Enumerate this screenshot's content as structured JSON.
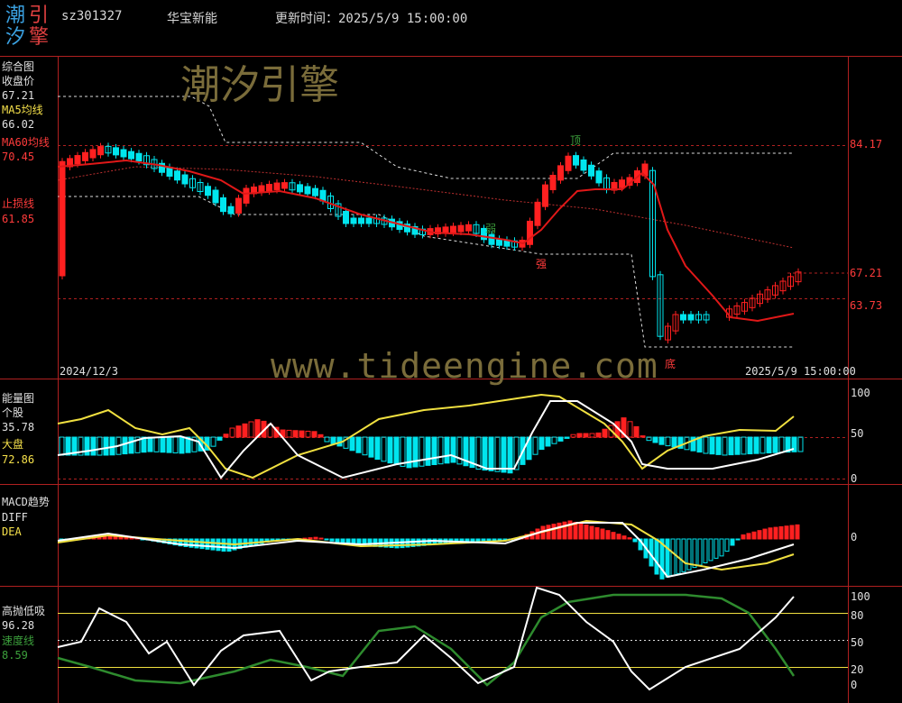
{
  "header": {
    "logo_chars": [
      "潮",
      "引",
      "汐",
      "擎"
    ],
    "code": "sz301327",
    "name": "华宝新能",
    "update_label": "更新时间：2025/5/9 15:00:00"
  },
  "watermarks": {
    "top": "潮汐引擎",
    "url": "www.tideengine.com"
  },
  "main_panel": {
    "title": "综合图",
    "close_label": "收盘价",
    "close_value": "67.21",
    "ma5_label": "MA5均线",
    "ma5_value": "66.02",
    "ma60_label": "MA60均线",
    "ma60_value": "70.45",
    "stop_label": "止损线",
    "stop_value": "61.85",
    "right_axis": [
      "84.17",
      "67.21",
      "63.73"
    ],
    "date_start": "2024/12/3",
    "date_end": "2025/5/9 15:00:00",
    "annotations": {
      "top": "顶",
      "weak": "弱",
      "strong": "强",
      "bottom": "底"
    }
  },
  "energy_panel": {
    "title": "能量图",
    "stock_label": "个股",
    "stock_value": "35.78",
    "market_label": "大盘",
    "market_value": "72.86",
    "axis": [
      "100",
      "50",
      "0"
    ]
  },
  "macd_panel": {
    "title": "MACD趋势",
    "diff_label": "DIFF",
    "dea_label": "DEA",
    "axis": [
      "0"
    ]
  },
  "osc_panel": {
    "title": "高抛低吸",
    "value": "96.28",
    "speed_label": "速度线",
    "speed_value": "8.59",
    "axis": [
      "100",
      "80",
      "50",
      "20",
      "0"
    ]
  },
  "colors": {
    "up": "#ff2020",
    "down": "#00e5ee",
    "ma": "#e01818",
    "yellow": "#f0e040",
    "green": "#2e8b2e"
  }
}
